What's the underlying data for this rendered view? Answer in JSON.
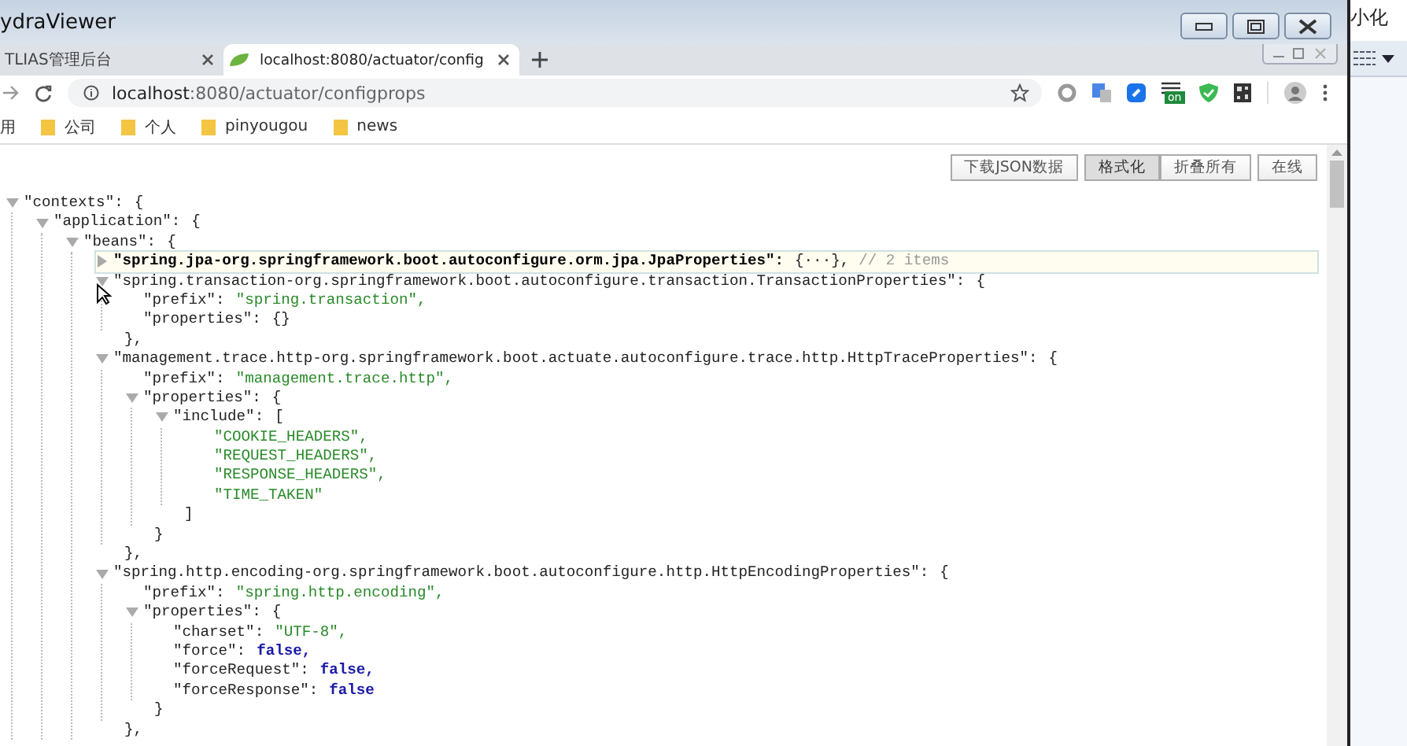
{
  "window": {
    "title": "ydraViewer"
  },
  "background_window": {
    "title": "小化"
  },
  "tabs": [
    {
      "label": "TLIAS管理后台",
      "selected": false
    },
    {
      "label": "localhost:8080/actuator/config",
      "selected": true
    }
  ],
  "address_bar": {
    "host": "localhost",
    "path": ":8080/actuator/configprops"
  },
  "extensions": [
    {
      "kind": "ring"
    },
    {
      "kind": "translate"
    },
    {
      "kind": "bubble"
    },
    {
      "kind": "list",
      "badge": "on"
    },
    {
      "kind": "shield"
    },
    {
      "kind": "qr"
    }
  ],
  "bookmarks": [
    {
      "label": "用",
      "kind": "apps"
    },
    {
      "label": "公司",
      "kind": "folder"
    },
    {
      "label": "个人",
      "kind": "folder"
    },
    {
      "label": "pinyougou",
      "kind": "folder"
    },
    {
      "label": "news",
      "kind": "folder"
    }
  ],
  "toolbar": [
    {
      "label": "下载JSON数据",
      "selected": false,
      "kind": "single"
    },
    {
      "label": "格式化",
      "selected": true,
      "kind": "segment"
    },
    {
      "label": "折叠所有",
      "selected": false,
      "kind": "segment"
    },
    {
      "label": "在线",
      "selected": false,
      "kind": "single"
    }
  ],
  "tree": [
    {
      "kind": "object",
      "key": "\"contexts\":",
      "open": "{",
      "expanded": true,
      "children": [
        {
          "kind": "object",
          "key": "\"application\":",
          "open": "{",
          "expanded": true,
          "children": [
            {
              "kind": "object",
              "key": "\"beans\":",
              "open": "{",
              "expanded": true,
              "children": [
                {
                  "kind": "object",
                  "key": "\"spring.jpa-org.springframework.boot.autoconfigure.orm.jpa.JpaProperties\":",
                  "open": "{···},",
                  "comment": "// 2 items",
                  "expanded": false,
                  "hovered": true
                },
                {
                  "kind": "object",
                  "key": "\"spring.transaction-org.springframework.boot.autoconfigure.transaction.TransactionProperties\":",
                  "open": "{",
                  "expanded": true,
                  "close": "},",
                  "hovered": false,
                  "children": [
                    {
                      "kind": "string",
                      "key": "\"prefix\":",
                      "value": "\"spring.transaction\","
                    },
                    {
                      "kind": "empty",
                      "key": "\"properties\":",
                      "value": "{}"
                    }
                  ]
                },
                {
                  "kind": "object",
                  "key": "\"management.trace.http-org.springframework.boot.actuate.autoconfigure.trace.http.HttpTraceProperties\":",
                  "open": "{",
                  "expanded": true,
                  "close": "},",
                  "children": [
                    {
                      "kind": "string",
                      "key": "\"prefix\":",
                      "value": "\"management.trace.http\","
                    },
                    {
                      "kind": "object",
                      "key": "\"properties\":",
                      "open": "{",
                      "expanded": true,
                      "close": "}",
                      "children": [
                        {
                          "kind": "object",
                          "key": "\"include\":",
                          "open": "[",
                          "expanded": true,
                          "close": "]",
                          "children": [
                            {
                              "kind": "string",
                              "value": "\"COOKIE_HEADERS\","
                            },
                            {
                              "kind": "string",
                              "value": "\"REQUEST_HEADERS\","
                            },
                            {
                              "kind": "string",
                              "value": "\"RESPONSE_HEADERS\","
                            },
                            {
                              "kind": "string",
                              "value": "\"TIME_TAKEN\""
                            }
                          ]
                        }
                      ]
                    }
                  ]
                },
                {
                  "kind": "object",
                  "key": "\"spring.http.encoding-org.springframework.boot.autoconfigure.http.HttpEncodingProperties\":",
                  "open": "{",
                  "expanded": true,
                  "close": "},",
                  "children": [
                    {
                      "kind": "string",
                      "key": "\"prefix\":",
                      "value": "\"spring.http.encoding\","
                    },
                    {
                      "kind": "object",
                      "key": "\"properties\":",
                      "open": "{",
                      "expanded": true,
                      "close": "}",
                      "children": [
                        {
                          "kind": "string",
                          "key": "\"charset\":",
                          "value": "\"UTF-8\","
                        },
                        {
                          "kind": "boolean",
                          "key": "\"force\":",
                          "value": "false,"
                        },
                        {
                          "kind": "boolean",
                          "key": "\"forceRequest\":",
                          "value": "false,"
                        },
                        {
                          "kind": "boolean",
                          "key": "\"forceResponse\":",
                          "value": "false"
                        }
                      ]
                    }
                  ]
                }
              ]
            }
          ]
        }
      ]
    }
  ]
}
